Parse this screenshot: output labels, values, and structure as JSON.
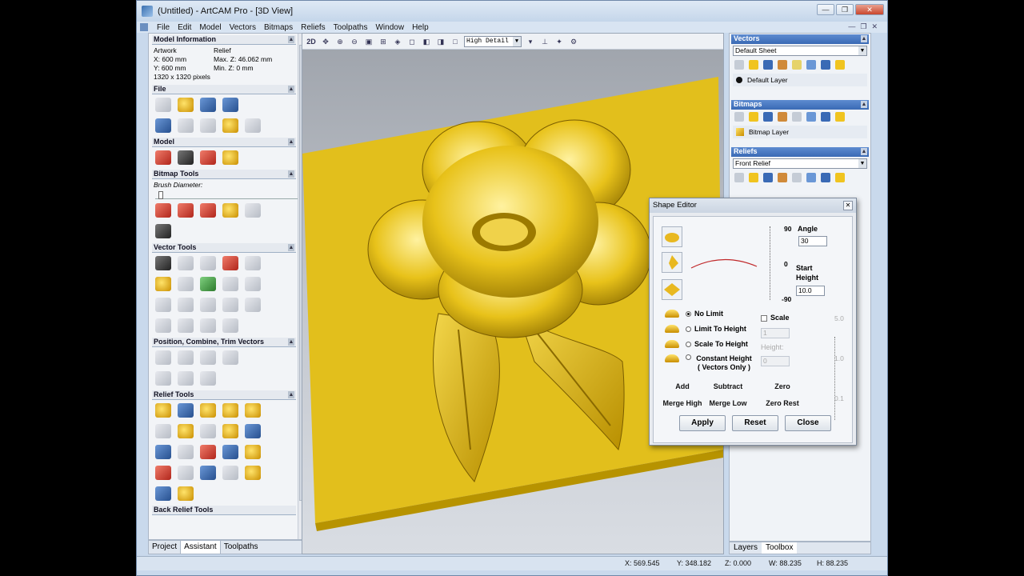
{
  "window": {
    "title": "(Untitled) - ArtCAM Pro - [3D View]"
  },
  "menu": [
    "File",
    "Edit",
    "Model",
    "Vectors",
    "Bitmaps",
    "Reliefs",
    "Toolpaths",
    "Window",
    "Help"
  ],
  "left_panel": {
    "model_info": {
      "header": "Model Information",
      "artwork_label": "Artwork",
      "relief_label": "Relief",
      "x": "X: 600 mm",
      "max_z": "Max. Z: 46.062 mm",
      "y": "Y: 600 mm",
      "min_z": "Min. Z: 0 mm",
      "pixels": "1320 x 1320 pixels"
    },
    "sections": {
      "file": "File",
      "model": "Model",
      "bitmap_tools": "Bitmap Tools",
      "brush_diameter": "Brush Diameter:",
      "vector_tools": "Vector Tools",
      "position_tools": "Position, Combine, Trim Vectors",
      "relief_tools": "Relief Tools",
      "back_relief_tools": "Back Relief Tools"
    },
    "tabs": [
      "Project",
      "Assistant",
      "Toolpaths"
    ],
    "active_tab": "Assistant"
  },
  "view_toolbar": {
    "mode_2d": "2D",
    "detail_select": "High Detail"
  },
  "right_panel": {
    "vectors": {
      "header": "Vectors",
      "sheet": "Default Sheet",
      "layer": "Default Layer"
    },
    "bitmaps": {
      "header": "Bitmaps",
      "layer": "Bitmap Layer"
    },
    "reliefs": {
      "header": "Reliefs",
      "select": "Front Relief"
    },
    "tabs": [
      "Layers",
      "Toolbox"
    ],
    "active_tab": "Toolbox"
  },
  "shape_editor": {
    "title": "Shape Editor",
    "slider_top": "90",
    "slider_mid": "0",
    "slider_bottom": "-90",
    "angle_label": "Angle",
    "angle_value": "30",
    "start_height_label": "Start Height",
    "start_height_value": "10.0",
    "options": [
      "No Limit",
      "Limit To Height",
      "Scale To Height",
      "Constant Height ( Vectors Only )"
    ],
    "selected_option": "No Limit",
    "scale_label": "Scale",
    "scale_value": "1",
    "height_label": "Height:",
    "height_value": "0",
    "ruler_top": "5.0",
    "ruler_mid": "1.0",
    "ruler_bottom": "0.1",
    "ops": [
      "Add",
      "Subtract",
      "Zero",
      "Merge High",
      "Merge Low",
      "Zero Rest"
    ],
    "apply": "Apply",
    "reset": "Reset",
    "close": "Close"
  },
  "status": {
    "x": "X: 569.545",
    "y": "Y: 348.182",
    "z": "Z: 0.000",
    "w": "W: 88.235",
    "h": "H: 88.235"
  },
  "colors": {
    "relief": "#e8c21a",
    "panel_header": "#3a6ab5"
  }
}
